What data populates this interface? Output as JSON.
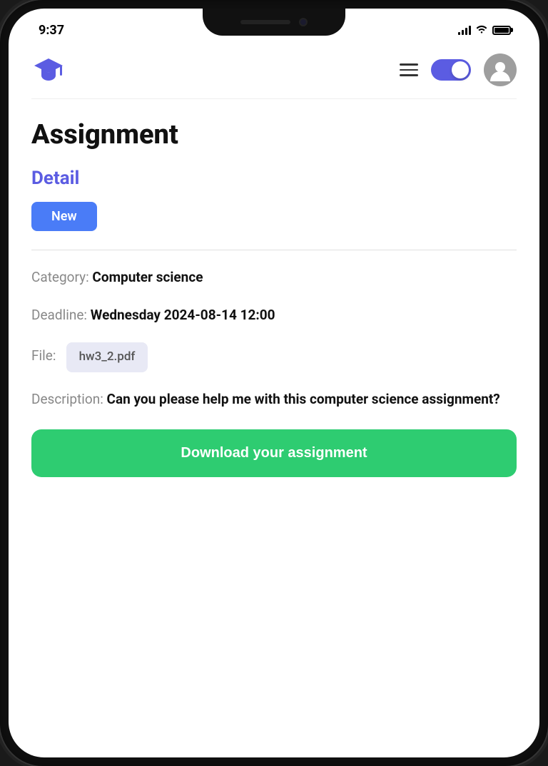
{
  "statusBar": {
    "time": "9:37"
  },
  "header": {
    "logoAlt": "graduation-cap-logo"
  },
  "pageTitle": "Assignment",
  "sectionLabel": "Detail",
  "badge": {
    "label": "New"
  },
  "details": {
    "categoryLabel": "Category:",
    "categoryValue": "Computer science",
    "deadlineLabel": "Deadline:",
    "deadlineValue": "Wednesday 2024-08-14 12:00",
    "fileLabel": "File:",
    "fileValue": "hw3_2.pdf",
    "descriptionLabel": "Description:",
    "descriptionValue": "Can you please help me with this computer science assignment?"
  },
  "downloadButton": {
    "label": "Download your assignment"
  },
  "colors": {
    "accent": "#5b5ce2",
    "green": "#2ecc71",
    "blue": "#4a7cf7"
  }
}
